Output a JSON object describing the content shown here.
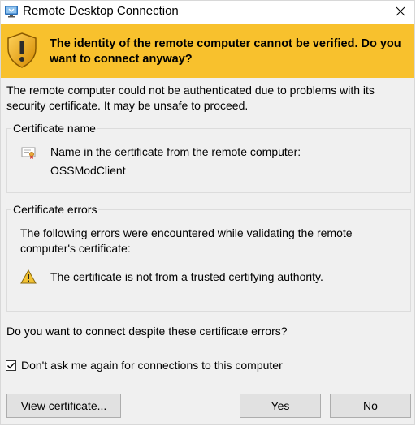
{
  "window": {
    "title": "Remote Desktop Connection",
    "app_icon": "remote-desktop-icon",
    "close_icon": "close-icon"
  },
  "banner": {
    "icon": "warning-shield-icon",
    "color": "#f8c12d",
    "text": "The identity of the remote computer cannot be verified. Do you want to connect anyway?"
  },
  "intro_text": "The remote computer could not be authenticated due to problems with its security certificate. It may be unsafe to proceed.",
  "certificate_name": {
    "group_title": "Certificate name",
    "icon": "certificate-icon",
    "label": "Name in the certificate from the remote computer:",
    "value": "OSSModClient"
  },
  "certificate_errors": {
    "group_title": "Certificate errors",
    "description": "The following errors were encountered while validating the remote computer's certificate:",
    "items": [
      {
        "icon": "warning-icon",
        "text": "The certificate is not from a trusted certifying authority."
      }
    ]
  },
  "question_text": "Do you want to connect despite these certificate errors?",
  "dont_ask": {
    "label": "Don't ask me again for connections to this computer",
    "checked": true
  },
  "buttons": {
    "view_certificate": "View certificate...",
    "yes": "Yes",
    "no": "No"
  }
}
